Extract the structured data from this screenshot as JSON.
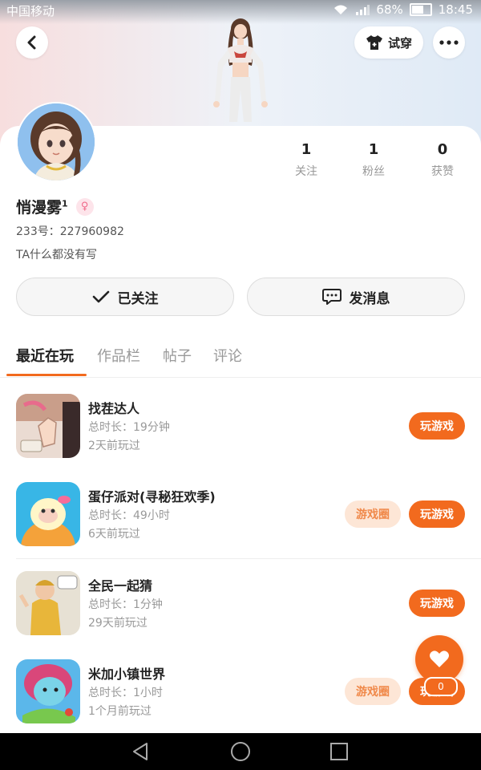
{
  "status_bar": {
    "carrier": "中国移动",
    "battery": "68%",
    "time": "18:45"
  },
  "header": {
    "try_on_label": "试穿"
  },
  "profile": {
    "stats": [
      {
        "value": "1",
        "label": "关注"
      },
      {
        "value": "1",
        "label": "粉丝"
      },
      {
        "value": "0",
        "label": "获赞"
      }
    ],
    "name": "悄漫雾",
    "name_superscript": "1",
    "gender_symbol": "♀",
    "uid": "233号：227960982",
    "bio": "TA什么都没有写",
    "following_label": "已关注",
    "message_label": "发消息"
  },
  "tabs": [
    "最近在玩",
    "作品栏",
    "帖子",
    "评论"
  ],
  "games": [
    {
      "title": "找茬达人",
      "duration": "总时长：19分钟",
      "last_played": "2天前玩过",
      "play_label": "玩游戏",
      "has_circle": false,
      "circle_label": ""
    },
    {
      "title": "蛋仔派对(寻秘狂欢季)",
      "duration": "总时长：49小时",
      "last_played": "6天前玩过",
      "play_label": "玩游戏",
      "has_circle": true,
      "circle_label": "游戏圈"
    },
    {
      "title": "全民一起猜",
      "duration": "总时长：1分钟",
      "last_played": "29天前玩过",
      "play_label": "玩游戏",
      "has_circle": false,
      "circle_label": ""
    },
    {
      "title": "米加小镇世界",
      "duration": "总时长：1小时",
      "last_played": "1个月前玩过",
      "play_label": "玩游戏",
      "has_circle": true,
      "circle_label": "游戏圈"
    }
  ],
  "favorite": {
    "count": "0"
  },
  "colors": {
    "accent": "#f26a1e",
    "accent_light": "#fde6d6"
  }
}
